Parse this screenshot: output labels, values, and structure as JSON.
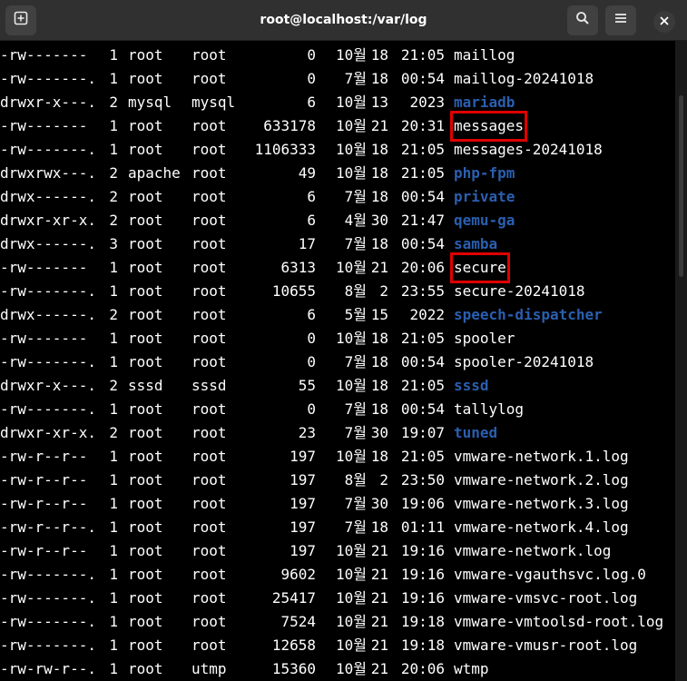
{
  "window": {
    "title": "root@localhost:/var/log"
  },
  "icons": {
    "new_tab": "new-tab-plus-icon",
    "search": "search-icon",
    "menu": "hamburger-menu-icon",
    "close": "close-icon"
  },
  "colors": {
    "directory": "#2a5fb0",
    "highlight_box": "#e00000",
    "text": "#ffffff",
    "background": "#000000",
    "titlebar": "#303030"
  },
  "listing": [
    {
      "perm": "-rw-------",
      "links": "1",
      "owner": "root",
      "group": "root",
      "size": "0",
      "month": "10월",
      "day": "18",
      "time": "21:05",
      "name": "maillog",
      "is_dir": false,
      "highlighted": false
    },
    {
      "perm": "-rw-------.",
      "links": "1",
      "owner": "root",
      "group": "root",
      "size": "0",
      "month": "7월",
      "day": "18",
      "time": "00:54",
      "name": "maillog-20241018",
      "is_dir": false,
      "highlighted": false
    },
    {
      "perm": "drwxr-x---.",
      "links": "2",
      "owner": "mysql",
      "group": "mysql",
      "size": "6",
      "month": "10월",
      "day": "13",
      "time": "2023",
      "name": "mariadb",
      "is_dir": true,
      "highlighted": false
    },
    {
      "perm": "-rw-------",
      "links": "1",
      "owner": "root",
      "group": "root",
      "size": "633178",
      "month": "10월",
      "day": "21",
      "time": "20:31",
      "name": "messages",
      "is_dir": false,
      "highlighted": true
    },
    {
      "perm": "-rw-------.",
      "links": "1",
      "owner": "root",
      "group": "root",
      "size": "1106333",
      "month": "10월",
      "day": "18",
      "time": "21:05",
      "name": "messages-20241018",
      "is_dir": false,
      "highlighted": false
    },
    {
      "perm": "drwxrwx---.",
      "links": "2",
      "owner": "apache",
      "group": "root",
      "size": "49",
      "month": "10월",
      "day": "18",
      "time": "21:05",
      "name": "php-fpm",
      "is_dir": true,
      "highlighted": false
    },
    {
      "perm": "drwx------.",
      "links": "2",
      "owner": "root",
      "group": "root",
      "size": "6",
      "month": "7월",
      "day": "18",
      "time": "00:54",
      "name": "private",
      "is_dir": true,
      "highlighted": false
    },
    {
      "perm": "drwxr-xr-x.",
      "links": "2",
      "owner": "root",
      "group": "root",
      "size": "6",
      "month": "4월",
      "day": "30",
      "time": "21:47",
      "name": "qemu-ga",
      "is_dir": true,
      "highlighted": false
    },
    {
      "perm": "drwx------.",
      "links": "3",
      "owner": "root",
      "group": "root",
      "size": "17",
      "month": "7월",
      "day": "18",
      "time": "00:54",
      "name": "samba",
      "is_dir": true,
      "highlighted": false
    },
    {
      "perm": "-rw-------",
      "links": "1",
      "owner": "root",
      "group": "root",
      "size": "6313",
      "month": "10월",
      "day": "21",
      "time": "20:06",
      "name": "secure",
      "is_dir": false,
      "highlighted": true
    },
    {
      "perm": "-rw-------.",
      "links": "1",
      "owner": "root",
      "group": "root",
      "size": "10655",
      "month": "8월",
      "day": "2",
      "time": "23:55",
      "name": "secure-20241018",
      "is_dir": false,
      "highlighted": false
    },
    {
      "perm": "drwx------.",
      "links": "2",
      "owner": "root",
      "group": "root",
      "size": "6",
      "month": "5월",
      "day": "15",
      "time": "2022",
      "name": "speech-dispatcher",
      "is_dir": true,
      "highlighted": false
    },
    {
      "perm": "-rw-------",
      "links": "1",
      "owner": "root",
      "group": "root",
      "size": "0",
      "month": "10월",
      "day": "18",
      "time": "21:05",
      "name": "spooler",
      "is_dir": false,
      "highlighted": false
    },
    {
      "perm": "-rw-------.",
      "links": "1",
      "owner": "root",
      "group": "root",
      "size": "0",
      "month": "7월",
      "day": "18",
      "time": "00:54",
      "name": "spooler-20241018",
      "is_dir": false,
      "highlighted": false
    },
    {
      "perm": "drwxr-x---.",
      "links": "2",
      "owner": "sssd",
      "group": "sssd",
      "size": "55",
      "month": "10월",
      "day": "18",
      "time": "21:05",
      "name": "sssd",
      "is_dir": true,
      "highlighted": false
    },
    {
      "perm": "-rw-------.",
      "links": "1",
      "owner": "root",
      "group": "root",
      "size": "0",
      "month": "7월",
      "day": "18",
      "time": "00:54",
      "name": "tallylog",
      "is_dir": false,
      "highlighted": false
    },
    {
      "perm": "drwxr-xr-x.",
      "links": "2",
      "owner": "root",
      "group": "root",
      "size": "23",
      "month": "7월",
      "day": "30",
      "time": "19:07",
      "name": "tuned",
      "is_dir": true,
      "highlighted": false
    },
    {
      "perm": "-rw-r--r--",
      "links": "1",
      "owner": "root",
      "group": "root",
      "size": "197",
      "month": "10월",
      "day": "18",
      "time": "21:05",
      "name": "vmware-network.1.log",
      "is_dir": false,
      "highlighted": false
    },
    {
      "perm": "-rw-r--r--",
      "links": "1",
      "owner": "root",
      "group": "root",
      "size": "197",
      "month": "8월",
      "day": "2",
      "time": "23:50",
      "name": "vmware-network.2.log",
      "is_dir": false,
      "highlighted": false
    },
    {
      "perm": "-rw-r--r--",
      "links": "1",
      "owner": "root",
      "group": "root",
      "size": "197",
      "month": "7월",
      "day": "30",
      "time": "19:06",
      "name": "vmware-network.3.log",
      "is_dir": false,
      "highlighted": false
    },
    {
      "perm": "-rw-r--r--.",
      "links": "1",
      "owner": "root",
      "group": "root",
      "size": "197",
      "month": "7월",
      "day": "18",
      "time": "01:11",
      "name": "vmware-network.4.log",
      "is_dir": false,
      "highlighted": false
    },
    {
      "perm": "-rw-r--r--",
      "links": "1",
      "owner": "root",
      "group": "root",
      "size": "197",
      "month": "10월",
      "day": "21",
      "time": "19:16",
      "name": "vmware-network.log",
      "is_dir": false,
      "highlighted": false
    },
    {
      "perm": "-rw-------.",
      "links": "1",
      "owner": "root",
      "group": "root",
      "size": "9602",
      "month": "10월",
      "day": "21",
      "time": "19:16",
      "name": "vmware-vgauthsvc.log.0",
      "is_dir": false,
      "highlighted": false
    },
    {
      "perm": "-rw-------.",
      "links": "1",
      "owner": "root",
      "group": "root",
      "size": "25417",
      "month": "10월",
      "day": "21",
      "time": "19:16",
      "name": "vmware-vmsvc-root.log",
      "is_dir": false,
      "highlighted": false
    },
    {
      "perm": "-rw-------.",
      "links": "1",
      "owner": "root",
      "group": "root",
      "size": "7524",
      "month": "10월",
      "day": "21",
      "time": "19:18",
      "name": "vmware-vmtoolsd-root.log",
      "is_dir": false,
      "highlighted": false
    },
    {
      "perm": "-rw-------.",
      "links": "1",
      "owner": "root",
      "group": "root",
      "size": "12658",
      "month": "10월",
      "day": "21",
      "time": "19:18",
      "name": "vmware-vmusr-root.log",
      "is_dir": false,
      "highlighted": false
    },
    {
      "perm": "-rw-rw-r--.",
      "links": "1",
      "owner": "root",
      "group": "utmp",
      "size": "15360",
      "month": "10월",
      "day": "21",
      "time": "20:06",
      "name": "wtmp",
      "is_dir": false,
      "highlighted": false
    }
  ]
}
